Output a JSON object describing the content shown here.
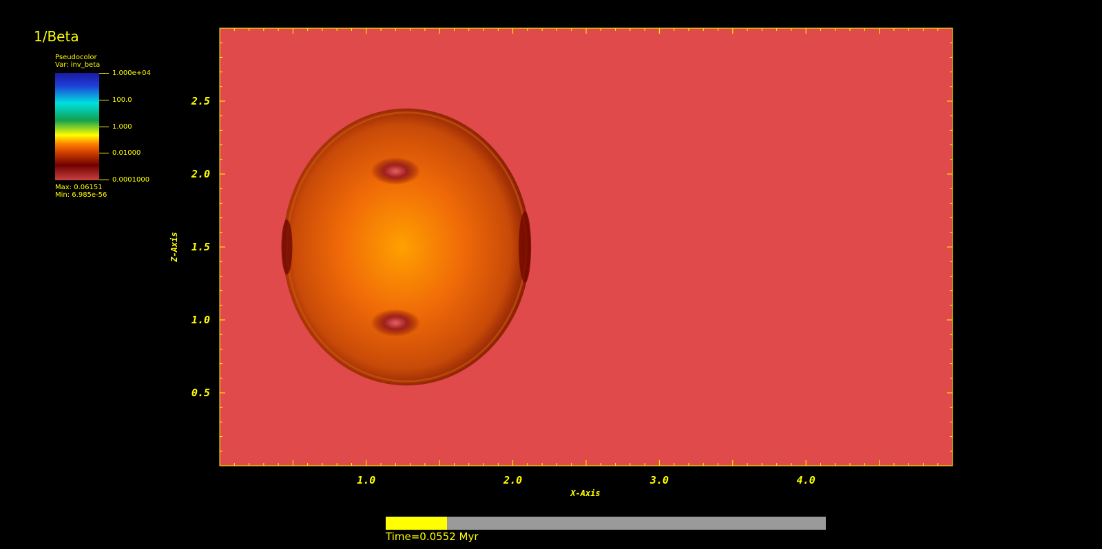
{
  "title": "1/Beta",
  "legend": {
    "type_label": "Pseudocolor",
    "var_label": "Var: inv_beta",
    "ticks": [
      "1.000e+04",
      "100.0",
      "1.000",
      "0.01000",
      "0.0001000"
    ],
    "max_label": "Max:  0.06151",
    "min_label": "Min:  6.985e-56"
  },
  "chart_data": {
    "type": "heatmap",
    "title": "1/Beta",
    "xlabel": "X-Axis",
    "ylabel": "Z-Axis",
    "xlim": [
      0,
      5
    ],
    "ylim": [
      0,
      3
    ],
    "x_ticks": [
      "1.0",
      "2.0",
      "3.0",
      "4.0"
    ],
    "y_ticks": [
      "0.5",
      "1.0",
      "1.5",
      "2.0",
      "2.5"
    ],
    "x_tick_values": [
      1,
      2,
      3,
      4
    ],
    "y_tick_values": [
      0.5,
      1.0,
      1.5,
      2.0,
      2.5
    ],
    "colormap_range": [
      0.0001,
      10000
    ],
    "background_color": "#e04a4a",
    "bubble": {
      "center_x": 1.2,
      "center_z": 1.5,
      "extent_x": [
        0.43,
        2.12
      ],
      "extent_z": [
        0.55,
        2.45
      ],
      "hotspots": [
        {
          "x": 1.2,
          "z": 2.02
        },
        {
          "x": 1.2,
          "z": 0.98
        }
      ]
    }
  },
  "time": {
    "label": "Time=0.0552 Myr",
    "progress": 0.14
  },
  "colors": {
    "text": "#ffff00",
    "background": "#000000",
    "field": "#e04a4a"
  }
}
